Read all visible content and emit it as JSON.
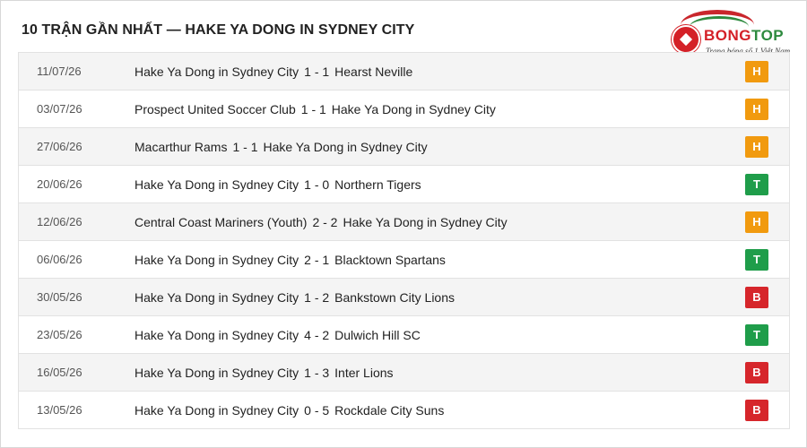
{
  "header": {
    "title": "10 TRẬN GẦN NHẤT — HAKE YA DONG IN SYDNEY CITY"
  },
  "logo": {
    "word_a": "BONG",
    "word_b": "TOP",
    "tagline": "Trang bóng số 1 Việt Nam"
  },
  "colors": {
    "H": "#f19a0f",
    "T": "#1f9d4a",
    "B": "#d6262b"
  },
  "matches": [
    {
      "date": "11/07/26",
      "home": "Hake Ya Dong in Sydney City",
      "score": "1 - 1",
      "away": "Hearst Neville",
      "result": "H"
    },
    {
      "date": "03/07/26",
      "home": "Prospect United Soccer Club",
      "score": "1 - 1",
      "away": "Hake Ya Dong in Sydney City",
      "result": "H"
    },
    {
      "date": "27/06/26",
      "home": "Macarthur Rams",
      "score": "1 - 1",
      "away": "Hake Ya Dong in Sydney City",
      "result": "H"
    },
    {
      "date": "20/06/26",
      "home": "Hake Ya Dong in Sydney City",
      "score": "1 - 0",
      "away": "Northern Tigers",
      "result": "T"
    },
    {
      "date": "12/06/26",
      "home": "Central Coast Mariners (Youth)",
      "score": "2 - 2",
      "away": "Hake Ya Dong in Sydney City",
      "result": "H"
    },
    {
      "date": "06/06/26",
      "home": "Hake Ya Dong in Sydney City",
      "score": "2 - 1",
      "away": "Blacktown Spartans",
      "result": "T"
    },
    {
      "date": "30/05/26",
      "home": "Hake Ya Dong in Sydney City",
      "score": "1 - 2",
      "away": "Bankstown City Lions",
      "result": "B"
    },
    {
      "date": "23/05/26",
      "home": "Hake Ya Dong in Sydney City",
      "score": "4 - 2",
      "away": "Dulwich Hill SC",
      "result": "T"
    },
    {
      "date": "16/05/26",
      "home": "Hake Ya Dong in Sydney City",
      "score": "1 - 3",
      "away": "Inter Lions",
      "result": "B"
    },
    {
      "date": "13/05/26",
      "home": "Hake Ya Dong in Sydney City",
      "score": "0 - 5",
      "away": "Rockdale City Suns",
      "result": "B"
    }
  ]
}
